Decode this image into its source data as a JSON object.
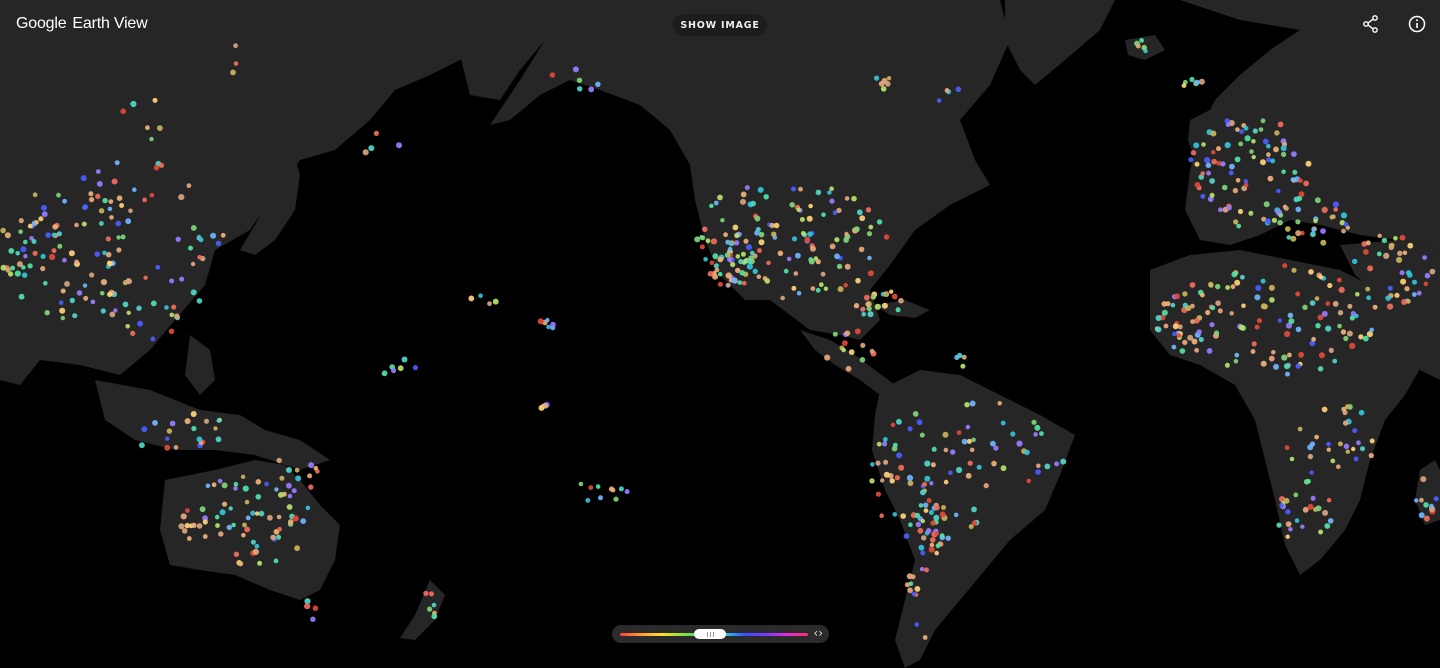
{
  "header": {
    "brand": "Google",
    "product": "Earth View",
    "show_image_label": "SHOW IMAGE"
  },
  "icons": {
    "share": "share-icon",
    "info": "info-icon"
  },
  "color_filter": {
    "gradient": [
      "#ff4040",
      "#ff9b2e",
      "#ffe02e",
      "#8fe23a",
      "#2ed08a",
      "#2ec7e0",
      "#3a4cff",
      "#7a3aff",
      "#e02ee0",
      "#ff2e6a"
    ],
    "arrows_label": "‹›"
  },
  "map": {
    "background": "#000000",
    "land_color": "#262626",
    "dot_palette": [
      "#e8a87c",
      "#d9a57e",
      "#f0b27a",
      "#4fd6c9",
      "#33c3d9",
      "#7fd67a",
      "#b6e36a",
      "#f26d5b",
      "#e34a3a",
      "#6fb6ff",
      "#4a5dff",
      "#9a7cff",
      "#c9b35a",
      "#50e3a4",
      "#ffd27a"
    ]
  }
}
